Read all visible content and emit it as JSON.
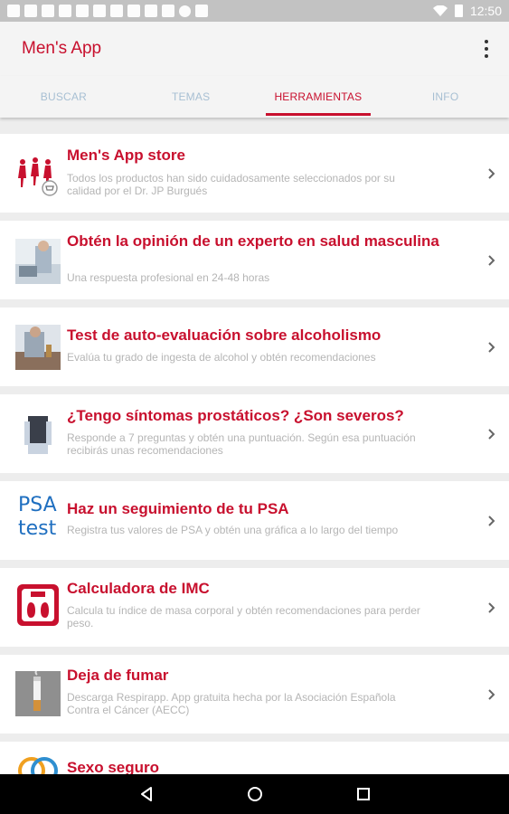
{
  "status": {
    "time": "12:50"
  },
  "app": {
    "title": "Men's App"
  },
  "tabs": [
    {
      "label": "BUSCAR"
    },
    {
      "label": "TEMAS"
    },
    {
      "label": "HERRAMIENTAS",
      "active": true
    },
    {
      "label": "INFO"
    }
  ],
  "items": [
    {
      "title": "Men's App store",
      "desc": "Todos los productos han sido cuidadosamente seleccionados por su calidad por el Dr. JP Burgués",
      "icon": "shopping-men-icon"
    },
    {
      "title": "Obtén la opinión de un experto en salud masculina",
      "desc": "Una respuesta profesional en 24-48 horas",
      "icon": "expert-photo"
    },
    {
      "title": "Test de auto-evaluación sobre alcoholismo",
      "desc": "Evalúa tu grado de ingesta de alcohol y obtén recomendaciones",
      "icon": "alcohol-photo"
    },
    {
      "title": "¿Tengo síntomas prostáticos? ¿Son severos?",
      "desc": "Responde a 7 preguntas y obtén una puntuación. Según esa puntuación recibirás unas recomendaciones",
      "icon": "prostate-photo"
    },
    {
      "title": "Haz un seguimiento de tu PSA",
      "desc": "Registra tus valores de PSA y obtén una gráfica a lo largo del tiempo",
      "icon": "psa-test-icon",
      "icon_text": [
        "PSA",
        "test"
      ]
    },
    {
      "title": "Calculadora de IMC",
      "desc": "Calcula tu índice de masa corporal y obtén recomendaciones para perder peso.",
      "icon": "scale-icon"
    },
    {
      "title": "Deja de fumar",
      "desc": "Descarga Respirapp. App gratuita hecha por la Asociación Española Contra el Cáncer (AECC)",
      "icon": "cigarette-photo"
    },
    {
      "title": "Sexo seguro",
      "desc": "",
      "icon": "rings-icon"
    }
  ],
  "colors": {
    "accent": "#c8102e",
    "tab_inactive": "#a7bfd3",
    "psa_blue": "#1f6fc0"
  }
}
